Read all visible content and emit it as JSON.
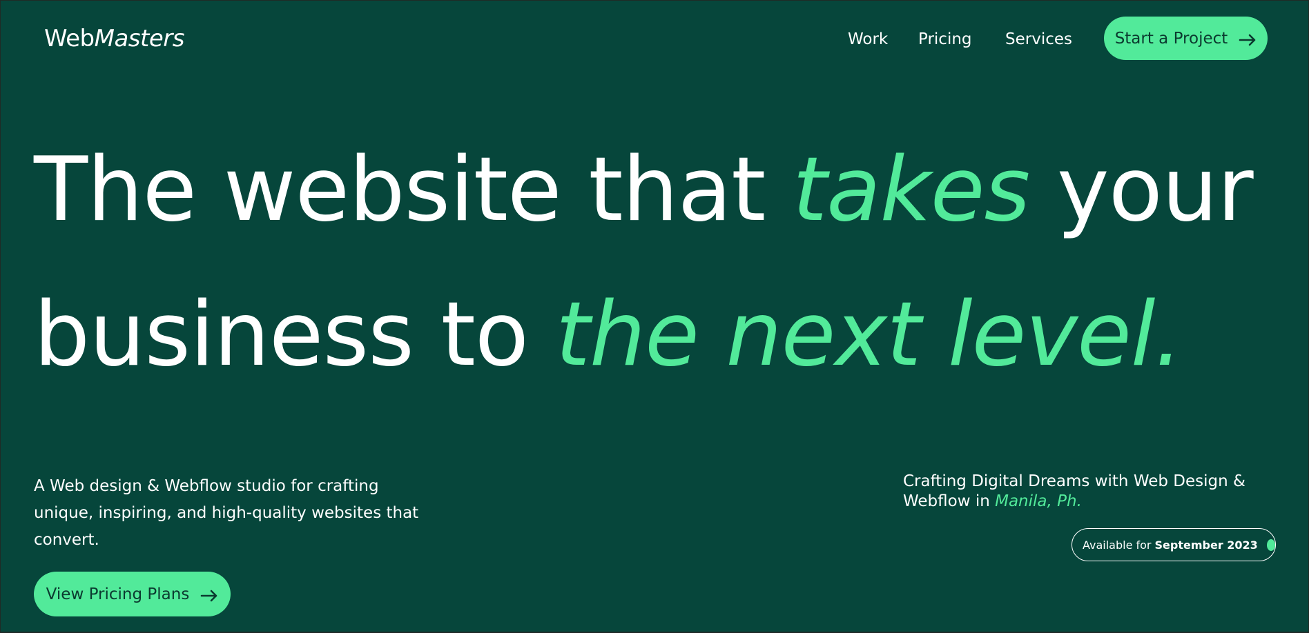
{
  "brand": {
    "name_regular": "Web",
    "name_italic": "Masters"
  },
  "nav": {
    "work": "Work",
    "pricing": "Pricing",
    "services": "Services",
    "cta": "Start a Project"
  },
  "hero": {
    "line1_a": "The website that ",
    "line1_accent": "takes",
    "line1_b": " your",
    "line2_a": "business to ",
    "line2_accent": "the next level."
  },
  "intro": {
    "text": "A Web design & Webflow studio for crafting unique, inspiring, and high-quality websites that convert.",
    "cta": "View Pricing Plans"
  },
  "tagline": {
    "text": "Crafting Digital Dreams with Web Design & Webflow in ",
    "location": "Manila, Ph."
  },
  "availability": {
    "label": "Available for",
    "date": "September 2023"
  },
  "icons": {
    "cta_arrow": "arrow-right-icon",
    "status": "status-dot-icon"
  },
  "colors": {
    "background": "#06463b",
    "accent": "#52ea9a",
    "button_text": "#0b3a2f",
    "text": "#ffffff"
  }
}
